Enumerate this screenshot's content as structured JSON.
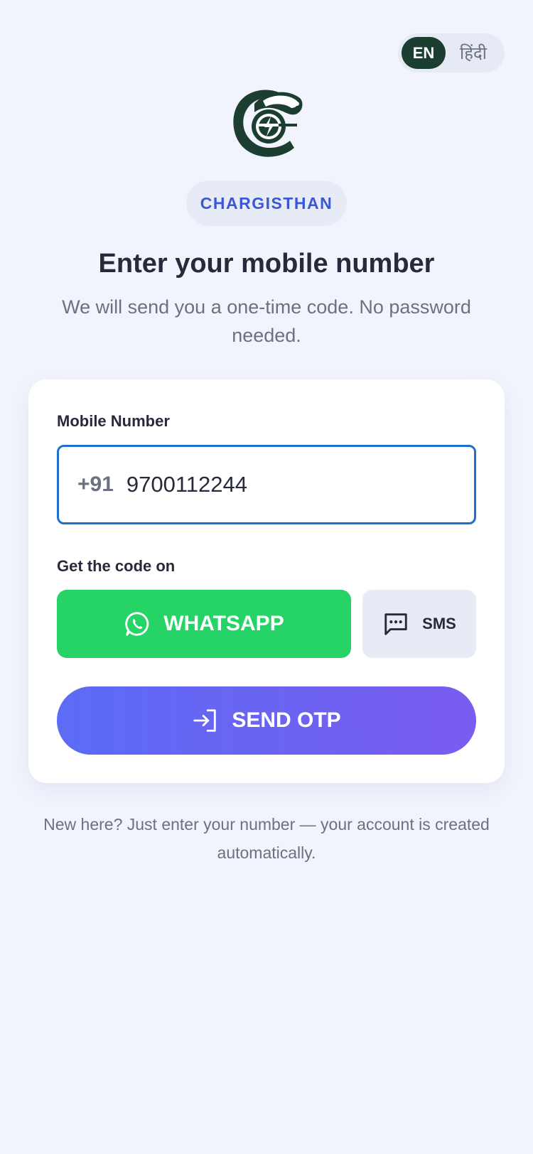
{
  "language_toggle": {
    "english_label": "EN",
    "hindi_label": "हिंदी",
    "active": "EN"
  },
  "brand": {
    "name": "CHARGISTHAN",
    "logo_icon": "chargisthan-logo-icon",
    "logo_color": "#1b3e30",
    "accent_color": "#3b57d6"
  },
  "header": {
    "title": "Enter your mobile number",
    "subtitle": "We will send you a one-time code. No password needed."
  },
  "form": {
    "mobile_label": "Mobile Number",
    "country_code": "+91",
    "mobile_value": "9700112244",
    "channel_label": "Get the code on",
    "whatsapp_label": "WHATSAPP",
    "whatsapp_icon": "whatsapp-icon",
    "whatsapp_color": "#26d366",
    "sms_label": "SMS",
    "sms_icon": "message-icon",
    "selected_channel": "WHATSAPP",
    "send_label": "SEND OTP",
    "send_icon": "login-icon"
  },
  "footer": {
    "note": "New here? Just enter your number — your account is created automatically."
  }
}
